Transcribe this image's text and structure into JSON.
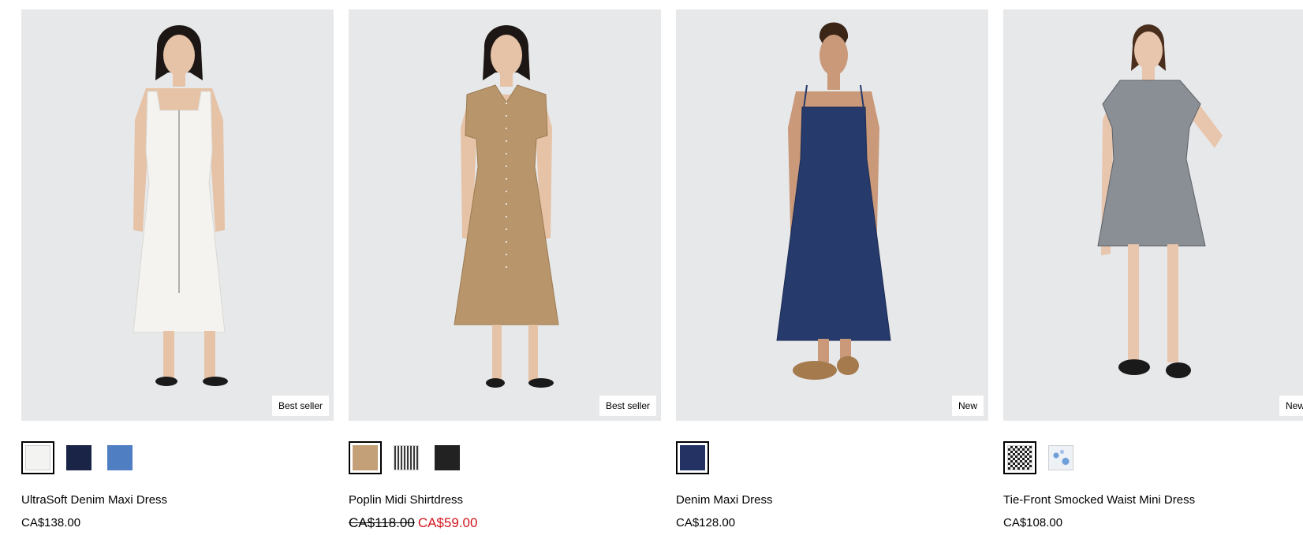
{
  "products": [
    {
      "name": "UltraSoft Denim Maxi Dress",
      "price": "CA$138.00",
      "sale_price": "",
      "badge": "Best seller",
      "dress_color": "#f4f3ef",
      "skin": "#e6c3a6",
      "hair": "#1c1714",
      "shoe": "#1a1a1a",
      "swatches": [
        {
          "color": "#f3f3f1",
          "selected": true
        },
        {
          "color": "#1a2447",
          "selected": false
        },
        {
          "color": "#4f7fc2",
          "selected": false
        }
      ]
    },
    {
      "name": "Poplin Midi Shirtdress",
      "price": "CA$118.00",
      "sale_price": "CA$59.00",
      "badge": "Best seller",
      "dress_color": "#b8956a",
      "skin": "#e6c3a6",
      "hair": "#1c1714",
      "shoe": "#1a1a1a",
      "swatches": [
        {
          "color": "#c4a078",
          "selected": true
        },
        {
          "color": "striped",
          "selected": false
        },
        {
          "color": "#222222",
          "selected": false
        }
      ]
    },
    {
      "name": "Denim Maxi Dress",
      "price": "CA$128.00",
      "sale_price": "",
      "badge": "New",
      "dress_color": "#263a6b",
      "skin": "#c99979",
      "hair": "#3a2517",
      "shoe": "#a57a4d",
      "swatches": [
        {
          "color": "#233263",
          "selected": true
        }
      ]
    },
    {
      "name": "Tie-Front Smocked Waist Mini Dress",
      "price": "CA$108.00",
      "sale_price": "",
      "badge": "New",
      "dress_color": "#8a8e95",
      "skin": "#e8c6ad",
      "hair": "#4a2e1d",
      "shoe": "#1a1a1a",
      "swatches": [
        {
          "color": "gingham",
          "selected": true
        },
        {
          "color": "floral",
          "selected": false
        }
      ]
    }
  ]
}
